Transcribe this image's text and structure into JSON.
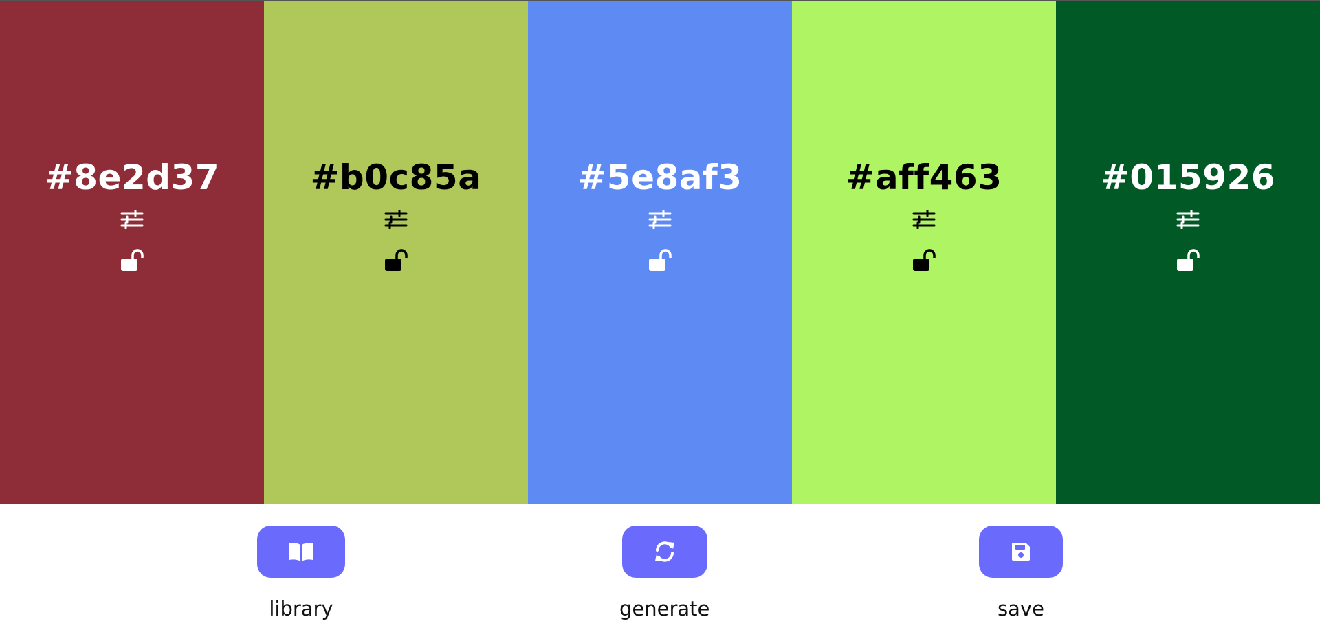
{
  "swatches": [
    {
      "hex": "#8e2d37",
      "background": "#8e2d37",
      "text_color": "#ffffff",
      "adjust_icon": "sliders-icon",
      "lock_icon": "unlock-icon",
      "locked": false
    },
    {
      "hex": "#b0c85a",
      "background": "#b0c85a",
      "text_color": "#000000",
      "adjust_icon": "sliders-icon",
      "lock_icon": "unlock-icon",
      "locked": false
    },
    {
      "hex": "#5e8af3",
      "background": "#5e8af3",
      "text_color": "#ffffff",
      "adjust_icon": "sliders-icon",
      "lock_icon": "unlock-icon",
      "locked": false
    },
    {
      "hex": "#aff463",
      "background": "#aff463",
      "text_color": "#000000",
      "adjust_icon": "sliders-icon",
      "lock_icon": "unlock-icon",
      "locked": false
    },
    {
      "hex": "#015926",
      "background": "#015926",
      "text_color": "#ffffff",
      "adjust_icon": "sliders-icon",
      "lock_icon": "unlock-icon",
      "locked": false
    }
  ],
  "controls": {
    "library": {
      "label": "library",
      "icon": "book-open-icon"
    },
    "generate": {
      "label": "generate",
      "icon": "refresh-icon"
    },
    "save": {
      "label": "save",
      "icon": "save-icon"
    }
  },
  "colors": {
    "button_bg": "#6a6afd",
    "button_icon": "#ffffff",
    "label_text": "#111111"
  }
}
